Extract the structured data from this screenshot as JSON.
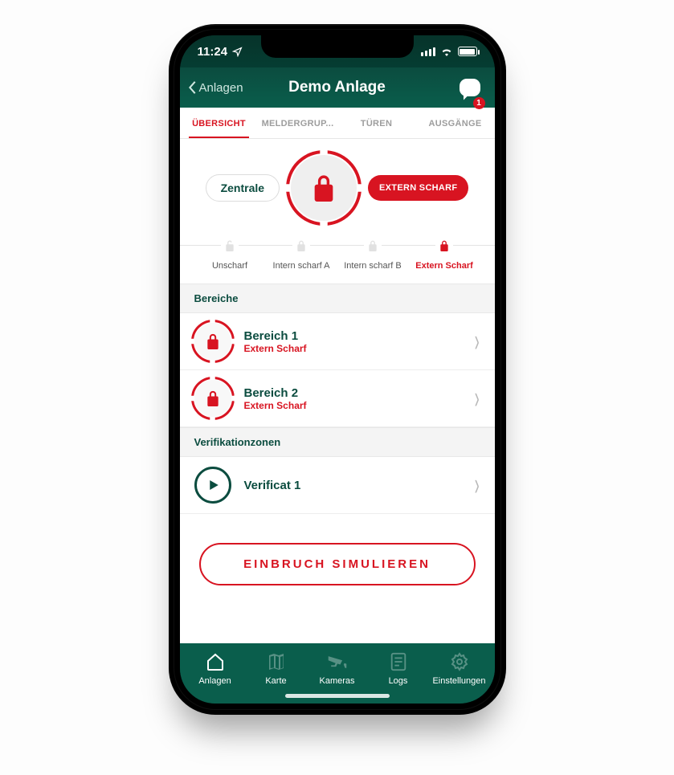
{
  "status": {
    "time": "11:24"
  },
  "nav": {
    "back": "Anlagen",
    "title": "Demo Anlage",
    "badge": "1"
  },
  "tabs": [
    {
      "label": "ÜBERSICHT",
      "active": true
    },
    {
      "label": "MELDERGRUP...",
      "active": false
    },
    {
      "label": "TÜREN",
      "active": false
    },
    {
      "label": "AUSGÄNGE",
      "active": false
    }
  ],
  "central": {
    "zone": "Zentrale",
    "status": "EXTERN SCHARF"
  },
  "modes": [
    {
      "label": "Unscharf",
      "active": false,
      "locked": false
    },
    {
      "label": "Intern scharf A",
      "active": false,
      "locked": true
    },
    {
      "label": "Intern scharf B",
      "active": false,
      "locked": true
    },
    {
      "label": "Extern Scharf",
      "active": true,
      "locked": true
    }
  ],
  "sections": {
    "areas_title": "Bereiche",
    "areas": [
      {
        "title": "Bereich 1",
        "sub": "Extern Scharf"
      },
      {
        "title": "Bereich 2",
        "sub": "Extern Scharf"
      }
    ],
    "verif_title": "Verifikationzonen",
    "verif": [
      {
        "title": "Verificat 1"
      }
    ]
  },
  "simulate": "EINBRUCH  SIMULIEREN",
  "bottom": [
    {
      "label": "Anlagen"
    },
    {
      "label": "Karte"
    },
    {
      "label": "Kameras"
    },
    {
      "label": "Logs"
    },
    {
      "label": "Einstellungen"
    }
  ]
}
